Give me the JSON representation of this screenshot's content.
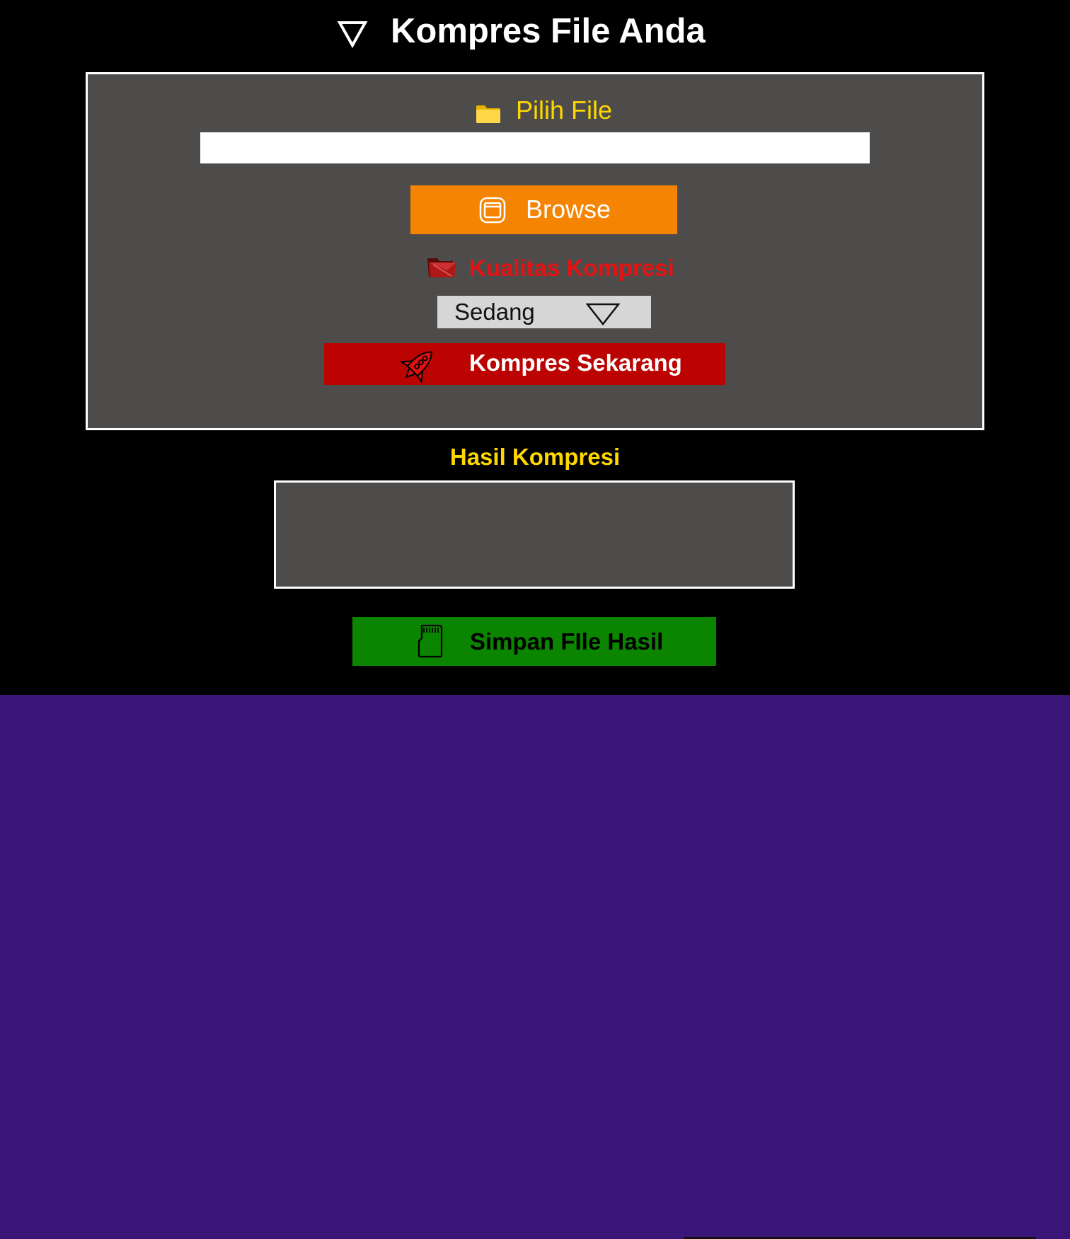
{
  "header": {
    "icon": "triangle-down-icon",
    "title": "Kompres File Anda"
  },
  "file_section": {
    "icon": "folder-icon",
    "label": "Pilih File",
    "input_value": "",
    "input_placeholder": ""
  },
  "browse_button": {
    "icon": "window-icon",
    "label": "Browse"
  },
  "quality_section": {
    "icon": "red-folder-icon",
    "label": "Kualitas Kompresi",
    "selected": "Sedang"
  },
  "compress_button": {
    "icon": "rocket-icon",
    "label": "Kompres Sekarang"
  },
  "result_section": {
    "title": "Hasil Kompresi",
    "content": ""
  },
  "save_button": {
    "icon": "sd-card-icon",
    "label": "Simpan FIle Hasil"
  },
  "colors": {
    "page_top": "#000000",
    "page_bottom": "#381577",
    "panel": "#4e4c4b",
    "accent_yellow": "#ffd700",
    "browse_orange": "#f58402",
    "compress_red": "#bb0302",
    "quality_red": "#e51212",
    "save_green": "#0b8500"
  }
}
